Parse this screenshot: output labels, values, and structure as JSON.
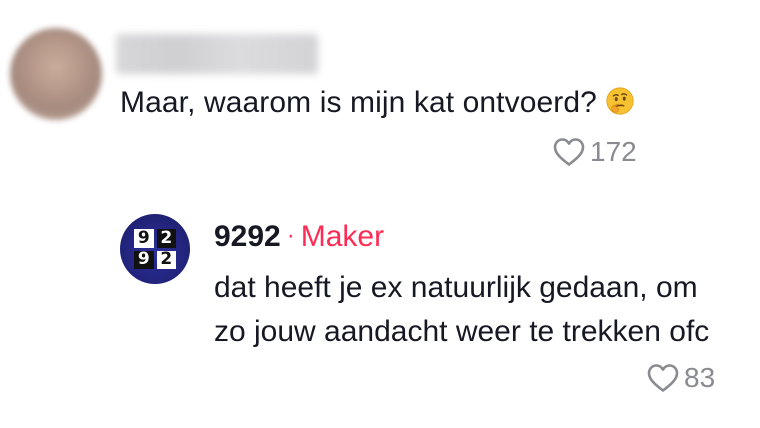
{
  "comment": {
    "text": "Maar, waarom is mijn kat ontvoerd?",
    "emoji": "thinking-face-emoji",
    "likes": "172"
  },
  "reply": {
    "author": "9292",
    "separator": "·",
    "badge": "Maker",
    "avatar_logo": [
      "9",
      "2",
      "9",
      "2"
    ],
    "text_lines": [
      "dat heeft je ex natuurlijk gedaan, om",
      "zo jouw aandacht weer te trekken ofc"
    ],
    "likes": "83"
  },
  "colors": {
    "accent": "#fe2c55",
    "muted": "#8a8b91",
    "text": "#161823",
    "avatar_bg": "#23257e"
  }
}
